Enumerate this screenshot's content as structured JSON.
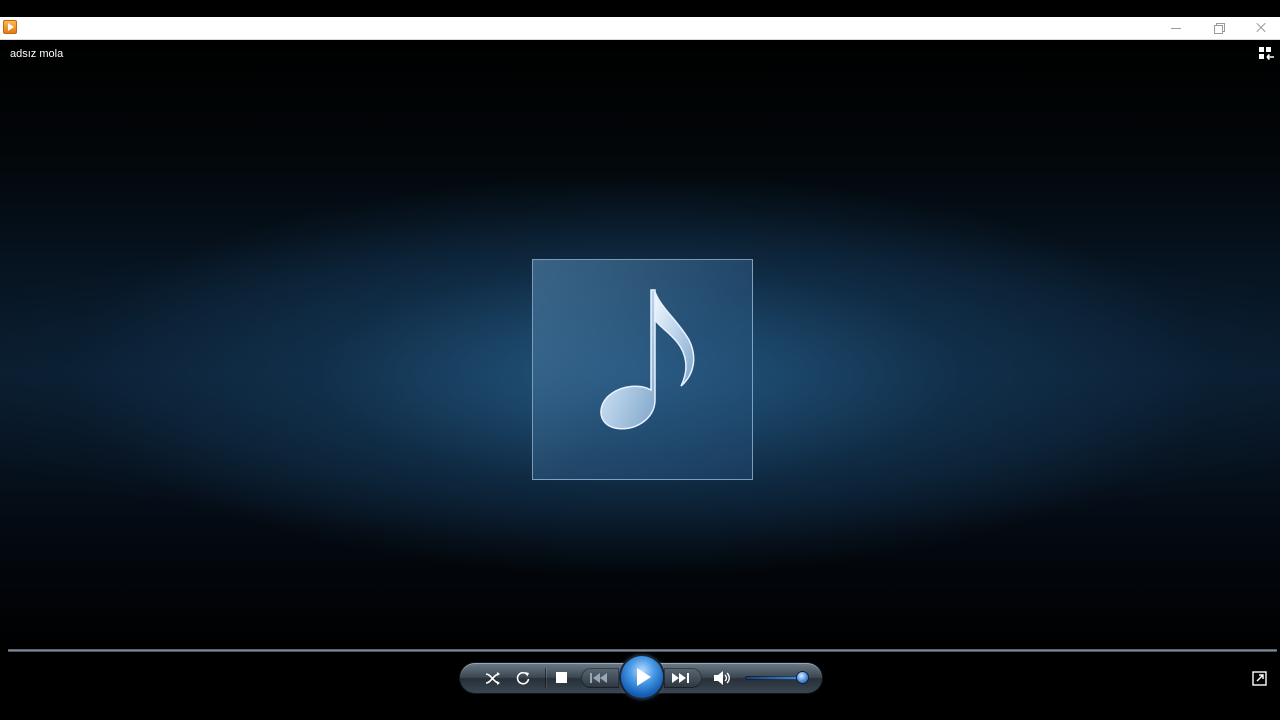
{
  "window": {
    "title": "",
    "app_icon": "media-player-icon",
    "buttons": [
      "minimize-icon",
      "restore-icon",
      "close-icon"
    ]
  },
  "now_playing": {
    "title": "adsız mola",
    "album_art_icon": "music-note-icon"
  },
  "seek": {
    "position_fraction": 0
  },
  "controls": {
    "icons": [
      "shuffle-icon",
      "repeat-icon",
      "stop-icon",
      "previous-icon",
      "play-icon",
      "next-icon",
      "volume-icon",
      "fullscreen-icon",
      "switch-to-library-icon"
    ],
    "volume_fraction": 0.9
  },
  "colors": {
    "accent": "#3a8ee6",
    "background": "#000000",
    "stage_glow": "#28608c"
  }
}
